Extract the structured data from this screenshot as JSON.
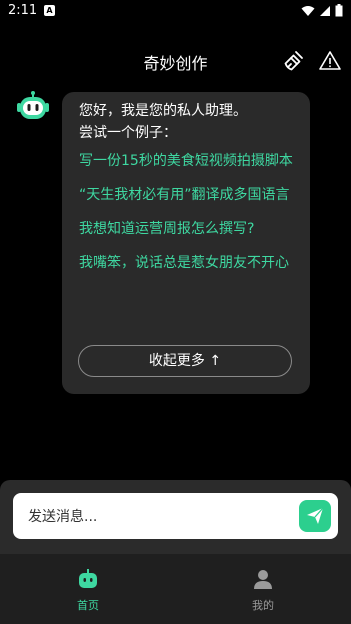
{
  "status_bar": {
    "time": "2:11",
    "notification_badge": "A"
  },
  "header": {
    "title": "奇妙创作",
    "icons": [
      "broom-clean-icon",
      "warning-icon"
    ]
  },
  "chat": {
    "greeting_line1": "您好，我是您的私人助理。",
    "greeting_line2": "尝试一个例子：",
    "suggestions": [
      "写一份15秒的美食短视频拍摄脚本",
      "“天生我材必有用”翻译成多国语言",
      "我想知道运营周报怎么撰写?",
      "我嘴笨，说话总是惹女朋友不开心"
    ],
    "collapse_label": "收起更多 ↑"
  },
  "input": {
    "placeholder": "发送消息..."
  },
  "bottom_nav": {
    "items": [
      {
        "label": "首页",
        "icon": "robot-home-icon",
        "active": true
      },
      {
        "label": "我的",
        "icon": "person-icon",
        "active": false
      }
    ]
  },
  "colors": {
    "accent": "#3ed8a1",
    "bubble_bg": "#2a2a2a",
    "send_button": "#2ccf8e",
    "background": "#000000"
  }
}
